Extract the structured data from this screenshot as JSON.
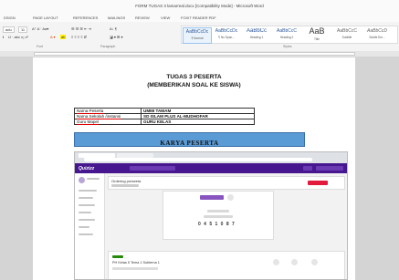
{
  "window": {
    "title": "FORM TUGAS 3 lamarreal.docx [Compatibility Mode] - Microsoft Word"
  },
  "tabs": [
    "DSIGN",
    "PAGE LAYOUT",
    "REFERENCES",
    "MAILINGS",
    "REVIEW",
    "VIEW",
    "FOXIT READER PDF"
  ],
  "ribbon": {
    "font_name": "adu",
    "font_size": "11",
    "groups": {
      "font": "Font",
      "paragraph": "Paragraph",
      "styles": "Styles"
    },
    "styles": [
      {
        "sample": "AaBbCcDc",
        "name": "¶ Normal"
      },
      {
        "sample": "AaBbCcDc",
        "name": "¶ No Spac..."
      },
      {
        "sample": "AaBbCc",
        "name": "Heading 1"
      },
      {
        "sample": "AaBbCcC",
        "name": "Heading 2"
      },
      {
        "sample": "AaB",
        "name": "Title"
      },
      {
        "sample": "AaBbCcC",
        "name": "Subtitle"
      },
      {
        "sample": "AaBbCcD",
        "name": "Subtle Em..."
      }
    ]
  },
  "document": {
    "heading1": "TUGAS 3 PESERTA",
    "heading2": "(MEMBERIKAN SOAL KE SISWA)",
    "info": [
      {
        "label": "Nama Peserta",
        "value": "UMMI TAMAM"
      },
      {
        "label": "Nama Sekolah /instansi",
        "value": "SD ISLAM PLUS AL-MUDHOFAR"
      },
      {
        "label": "Guru Mapel",
        "value": "GURU KELAS"
      }
    ],
    "banner": "KARYA PESERTA",
    "screenshot": {
      "logo": "Quizizz",
      "quiz_title": "Ordering preseeta",
      "join_code": "0 4 5 1 0 8 7",
      "footer_title": "PH Kelas 5 Tema 1 Subtema 1"
    }
  }
}
